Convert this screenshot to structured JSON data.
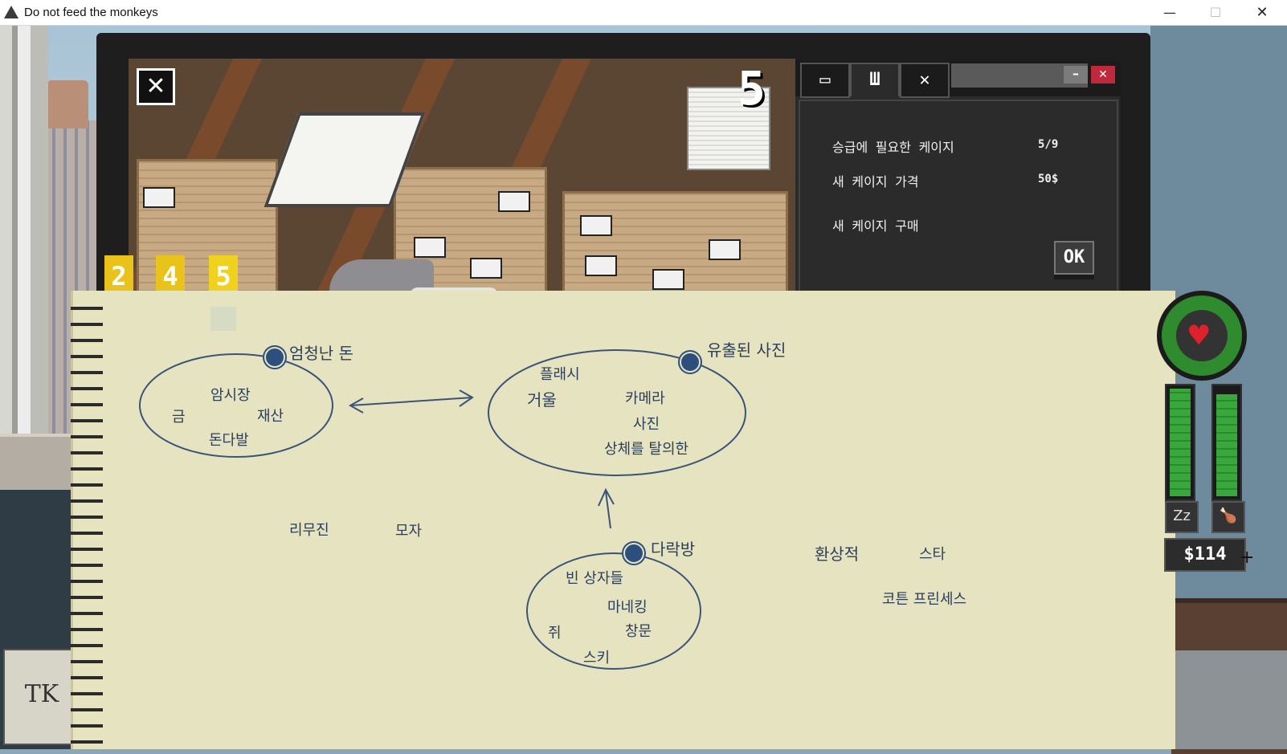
{
  "window": {
    "title": "Do not feed the monkeys",
    "controls": {
      "minimize": "—",
      "maximize": "☐",
      "close": "✕"
    }
  },
  "camera": {
    "close_glyph": "✕",
    "number": "5",
    "tabs": [
      "2",
      "4",
      "5"
    ],
    "active_tab": "5"
  },
  "panel": {
    "tabs": [
      {
        "icon": "film-icon",
        "glyph": "▭"
      },
      {
        "icon": "cage-icon",
        "glyph": "Ш"
      },
      {
        "icon": "close-icon",
        "glyph": "✕"
      }
    ],
    "minimize_glyph": "–",
    "close_glyph": "✕",
    "rows": [
      {
        "label": "승급에 필요한 케이지",
        "value": "5/9"
      },
      {
        "label": "새 케이지 가격",
        "value": "50$"
      }
    ],
    "buy_label": "새 케이지 구매",
    "ok_label": "OK"
  },
  "notebook": {
    "clusters": [
      {
        "title": "엄청난 돈",
        "words": [
          "암시장",
          "금",
          "재산",
          "돈다발"
        ]
      },
      {
        "title": "유출된 사진",
        "words": [
          "플래시",
          "거울",
          "카메라",
          "사진",
          "상체를 탈의한"
        ]
      },
      {
        "title": "다락방",
        "words": [
          "빈 상자들",
          "마네킹",
          "쥐",
          "창문",
          "스키"
        ]
      }
    ],
    "loose_words": [
      "리무진",
      "모자",
      "환상적",
      "스타",
      "코튼 프린세스"
    ]
  },
  "hud": {
    "heart_glyph": "♥",
    "hunger_level": 1.0,
    "energy_level": 0.95,
    "sleep_icon": "Zz",
    "food_icon": "🍗",
    "money": "$114"
  }
}
